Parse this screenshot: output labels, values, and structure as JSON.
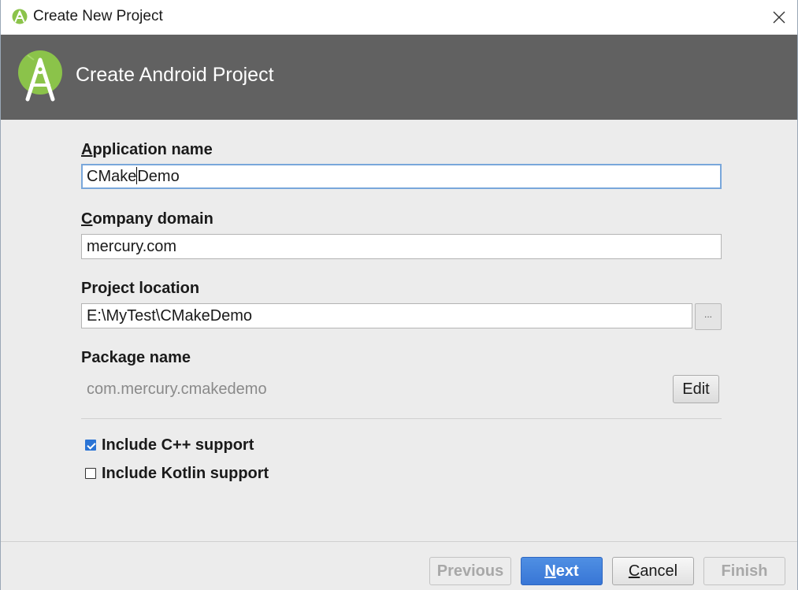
{
  "window": {
    "title": "Create New Project"
  },
  "header": {
    "title": "Create Android Project"
  },
  "form": {
    "app_name": {
      "label_mnemonic": "A",
      "label_rest": "pplication name",
      "value_before_caret": "CMake",
      "value_after_caret": "Demo"
    },
    "company_domain": {
      "label_mnemonic": "C",
      "label_rest": "ompany domain",
      "value": "mercury.com"
    },
    "project_location": {
      "label": "Project location",
      "value": "E:\\MyTest\\CMakeDemo",
      "browse_label": "..."
    },
    "package_name": {
      "label": "Package name",
      "value": "com.mercury.cmakedemo",
      "edit_label": "Edit"
    }
  },
  "options": [
    {
      "label": "Include C++ support",
      "checked": true
    },
    {
      "label": "Include Kotlin support",
      "checked": false
    }
  ],
  "footer": {
    "previous_label": "Previous",
    "next_mnemonic": "N",
    "next_rest": "ext",
    "cancel_mnemonic": "C",
    "cancel_rest": "ancel",
    "finish_label": "Finish"
  },
  "colors": {
    "header_bg": "#616161",
    "android_green": "#8bc34a",
    "primary_button": "#3876d6"
  },
  "icons": {
    "window": "android-studio-icon",
    "header": "android-studio-logo-icon",
    "close": "close-icon"
  }
}
